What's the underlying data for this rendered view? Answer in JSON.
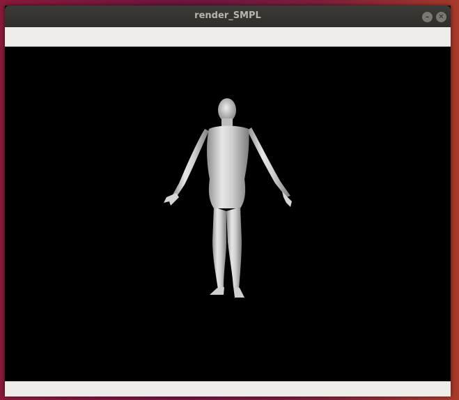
{
  "window": {
    "title": "render_SMPL",
    "minimize_icon": "minimize-icon",
    "close_icon": "close-icon",
    "minimize_glyph": "–",
    "close_glyph": "✕"
  },
  "viewport": {
    "background": "#000000",
    "subject": "human-body-mesh",
    "mesh_color": "#d9d9d9"
  }
}
